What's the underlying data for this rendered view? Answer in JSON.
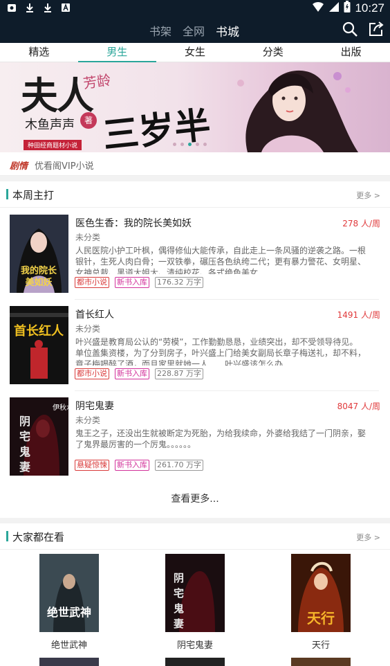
{
  "status_bar": {
    "time": "10:27"
  },
  "top_nav": {
    "tabs": [
      {
        "label": "书架"
      },
      {
        "label": "全网"
      },
      {
        "label": "书城"
      }
    ]
  },
  "category_tabs": [
    {
      "label": "精选"
    },
    {
      "label": "男生"
    },
    {
      "label": "女生"
    },
    {
      "label": "分类"
    },
    {
      "label": "出版"
    }
  ],
  "banner": {
    "title_part1": "夫人",
    "title_part2": "芳龄",
    "title_part3": "三岁半",
    "author": "木鱼声声",
    "seal": "著",
    "ribbon": "种田经商题材小说"
  },
  "vip": {
    "icon_text": "剧情",
    "label": "优看阁VIP小说"
  },
  "weekly": {
    "title": "本周主打",
    "more": "更多 >",
    "books": [
      {
        "name": "医色生香：我的院长美如妖",
        "reads": "278 人/周",
        "category": "未分类",
        "desc": "人民医院小护工叶枫，偶得修仙大能传承，自此走上一条风骚的逆袭之路。一根银针，生死人肉白骨；一双铁拳，碾压各色纨绔二代；更有暴力警花、女明星、女神总裁、黑道大姐大、清纯校花、各式绝色美女",
        "tags": [
          "都市小说",
          "新书入库",
          "176.32 万字"
        ],
        "cover_text": "我的院长美如妖"
      },
      {
        "name": "首长红人",
        "reads": "1491 人/周",
        "category": "未分类",
        "desc": "叶兴盛是教育局公认的“劳模”，工作勤勤恳恳，业绩突出，却不受领导待见。单位盖集资楼，为了分到房子，叶兴盛上门给美女副局长章子梅送礼，却不料，章子梅喝醉了酒，而且家里就她一人……叶兴盛该怎么办",
        "tags": [
          "都市小说",
          "新书入库",
          "228.87 万字"
        ],
        "cover_text": "首长红人"
      },
      {
        "name": "阴宅鬼妻",
        "reads": "8047 人/周",
        "category": "未分类",
        "desc": "鬼王之子，还没出生就被断定为死胎，为给我续命，外婆给我结了一门阴亲，娶了鬼界最厉害的一个厉鬼。。。。。。",
        "tags": [
          "悬疑惊悚",
          "新书入库",
          "261.70 万字"
        ],
        "cover_text": "伊秋水"
      }
    ],
    "see_more": "查看更多..."
  },
  "popular": {
    "title": "大家都在看",
    "more": "更多 >",
    "books": [
      {
        "name": "绝世武神"
      },
      {
        "name": "阴宅鬼妻"
      },
      {
        "name": "天行"
      }
    ]
  },
  "colors": {
    "accent": "#2aa69a",
    "dark_bar": "#0e1c2a",
    "red": "#e0393b",
    "pink": "#d2319a"
  }
}
